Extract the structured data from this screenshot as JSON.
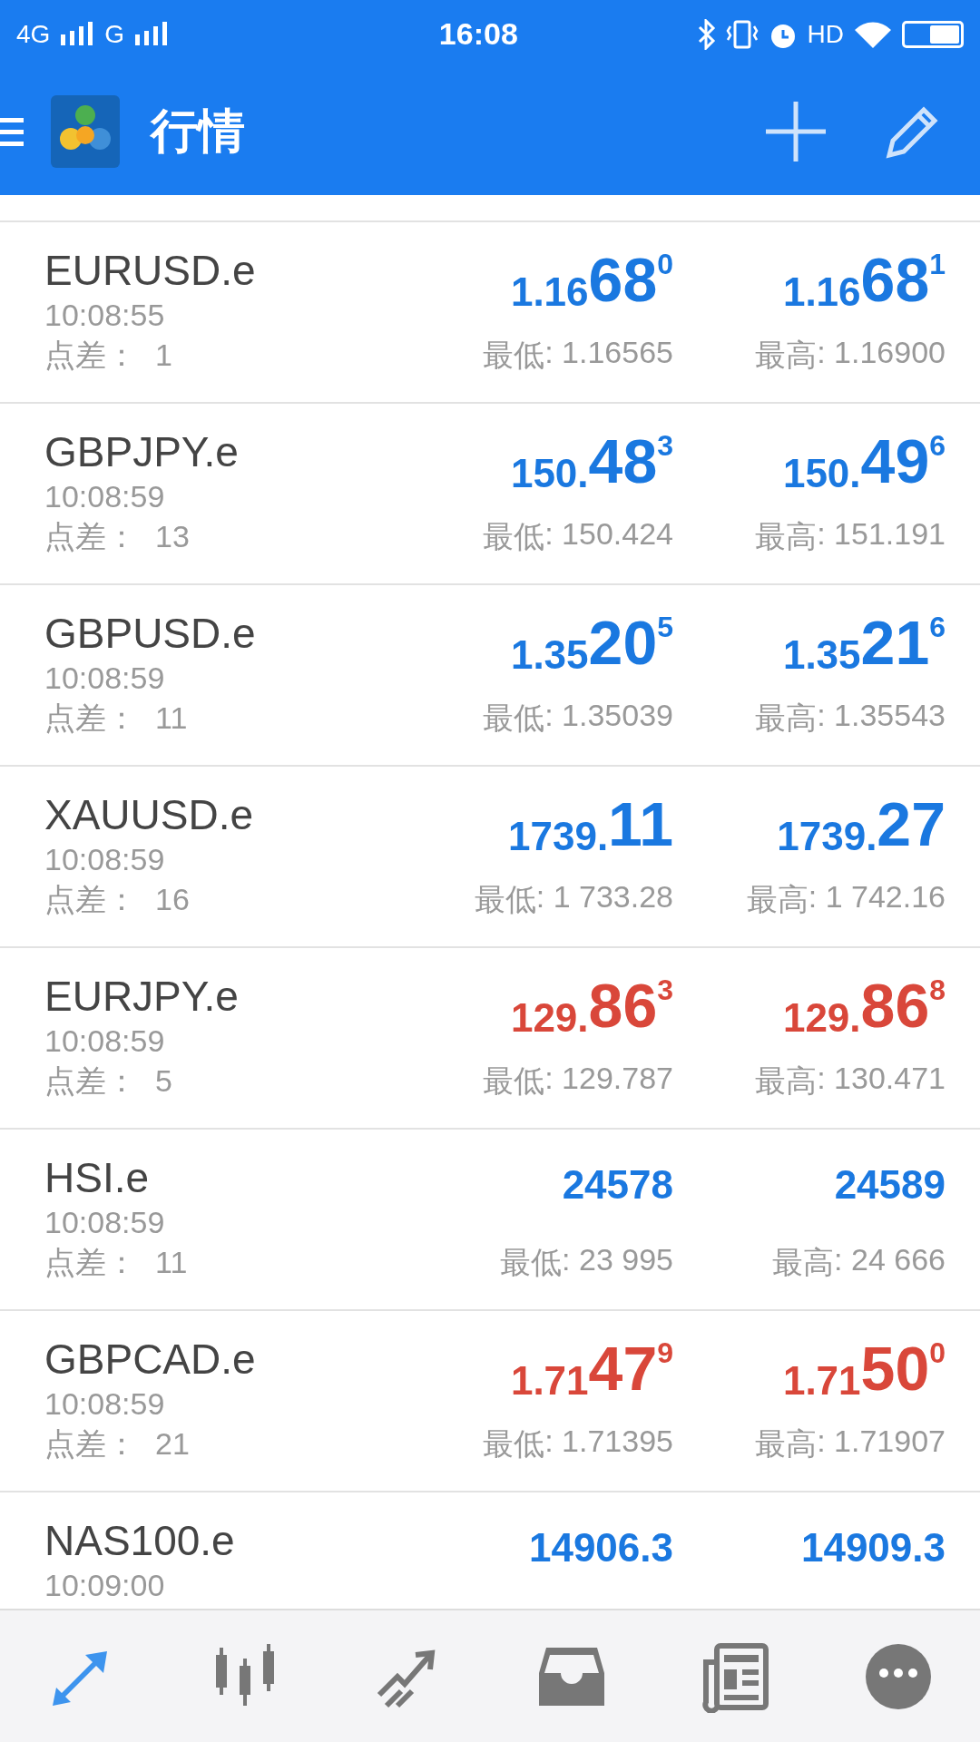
{
  "status_bar": {
    "network_1": "4G",
    "network_2": "G",
    "time": "16:08",
    "hd": "HD"
  },
  "header": {
    "title": "行情"
  },
  "quotes": [
    {
      "symbol": "EURUSD.e",
      "time": "10:08:55",
      "spread_label": "点差：",
      "spread": "1",
      "color": "#1a78e0",
      "bid": {
        "small": "1.16",
        "big": "68",
        "sup": "0"
      },
      "ask": {
        "small": "1.16",
        "big": "68",
        "sup": "1"
      },
      "low_label": "最低",
      "low": ": 1.16565",
      "high_label": "最高",
      "high": ": 1.16900"
    },
    {
      "symbol": "GBPJPY.e",
      "time": "10:08:59",
      "spread_label": "点差：",
      "spread": "13",
      "color": "#1a78e0",
      "bid": {
        "small": "150.",
        "big": "48",
        "sup": "3"
      },
      "ask": {
        "small": "150.",
        "big": "49",
        "sup": "6"
      },
      "low_label": "最低",
      "low": ": 150.424",
      "high_label": "最高",
      "high": ": 151.191"
    },
    {
      "symbol": "GBPUSD.e",
      "time": "10:08:59",
      "spread_label": "点差：",
      "spread": "11",
      "color": "#1a78e0",
      "bid": {
        "small": "1.35",
        "big": "20",
        "sup": "5"
      },
      "ask": {
        "small": "1.35",
        "big": "21",
        "sup": "6"
      },
      "low_label": "最低",
      "low": ": 1.35039",
      "high_label": "最高",
      "high": ": 1.35543"
    },
    {
      "symbol": "XAUUSD.e",
      "time": "10:08:59",
      "spread_label": "点差：",
      "spread": "16",
      "color": "#1a78e0",
      "bid": {
        "small": "1739.",
        "big": "11"
      },
      "ask": {
        "small": "1739.",
        "big": "27"
      },
      "low_label": "最低",
      "low": ": 1 733.28",
      "high_label": "最高",
      "high": ": 1 742.16"
    },
    {
      "symbol": "EURJPY.e",
      "time": "10:08:59",
      "spread_label": "点差：",
      "spread": "5",
      "color": "#d9473a",
      "bid": {
        "small": "129.",
        "big": "86",
        "sup": "3"
      },
      "ask": {
        "small": "129.",
        "big": "86",
        "sup": "8"
      },
      "low_label": "最低",
      "low": ": 129.787",
      "high_label": "最高",
      "high": ": 130.471"
    },
    {
      "symbol": "HSI.e",
      "time": "10:08:59",
      "spread_label": "点差：",
      "spread": "11",
      "color": "#1a78e0",
      "bid": {
        "small": "24578"
      },
      "ask": {
        "small": "24589"
      },
      "low_label": "最低",
      "low": ": 23 995",
      "high_label": "最高",
      "high": ": 24 666"
    },
    {
      "symbol": "GBPCAD.e",
      "time": "10:08:59",
      "spread_label": "点差：",
      "spread": "21",
      "color": "#d9473a",
      "bid": {
        "small": "1.71",
        "big": "47",
        "sup": "9"
      },
      "ask": {
        "small": "1.71",
        "big": "50",
        "sup": "0"
      },
      "low_label": "最低",
      "low": ": 1.71395",
      "high_label": "最高",
      "high": ": 1.71907"
    },
    {
      "symbol": "NAS100.e",
      "time": "10:09:00",
      "color": "#1a78e0",
      "bid": {
        "small": "14906.3"
      },
      "ask": {
        "small": "14909.3"
      }
    }
  ],
  "nav": [
    {
      "kind": "quotes",
      "selected": true
    },
    {
      "kind": "chart",
      "selected": false
    },
    {
      "kind": "trade",
      "selected": false
    },
    {
      "kind": "history",
      "selected": false
    },
    {
      "kind": "news",
      "selected": false
    },
    {
      "kind": "chat",
      "selected": false
    }
  ]
}
